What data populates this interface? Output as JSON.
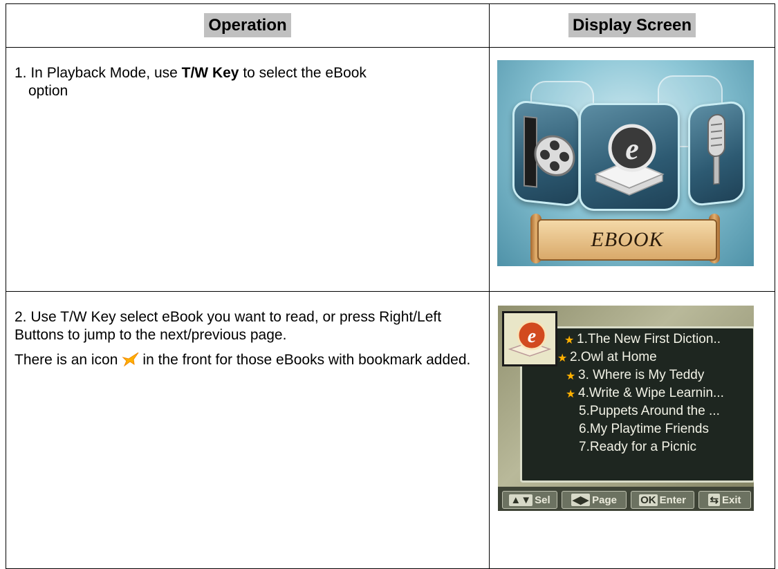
{
  "headers": {
    "operation": "Operation",
    "display": "Display Screen"
  },
  "rows": [
    {
      "step_prefix": "1. In Playback Mode, use ",
      "step_bold": "T/W Key",
      "step_suffix": " to select the eBook",
      "step_cont": "option",
      "screen_caption": "EBOOK"
    },
    {
      "para1": "2. Use T/W Key select eBook you want to read, or press Right/Left Buttons to jump to the next/previous page.",
      "para2_prefix": "There is an icon",
      "para2_suffix": "in the front for those eBooks with bookmark added.",
      "ebooks": [
        {
          "title": "1.The New First Diction..",
          "bookmarked": true
        },
        {
          "title": "2.Owl at Home",
          "bookmarked": true
        },
        {
          "title": "3. Where is My Teddy",
          "bookmarked": true
        },
        {
          "title": "4.Write & Wipe Learnin...",
          "bookmarked": true
        },
        {
          "title": "5.Puppets Around the ...",
          "bookmarked": false
        },
        {
          "title": "6.My Playtime Friends",
          "bookmarked": false
        },
        {
          "title": "7.Ready for a Picnic",
          "bookmarked": false
        }
      ],
      "bar": {
        "sel_keys": "▲▼",
        "sel_label": "Sel",
        "page_keys": "◀▶",
        "page_label": "Page",
        "ok_key": "OK",
        "ok_label": "Enter",
        "exit_label": "Exit"
      }
    }
  ],
  "colors": {
    "header_bg": "#c0c0c0",
    "bookmark_star": "#ffb000"
  }
}
